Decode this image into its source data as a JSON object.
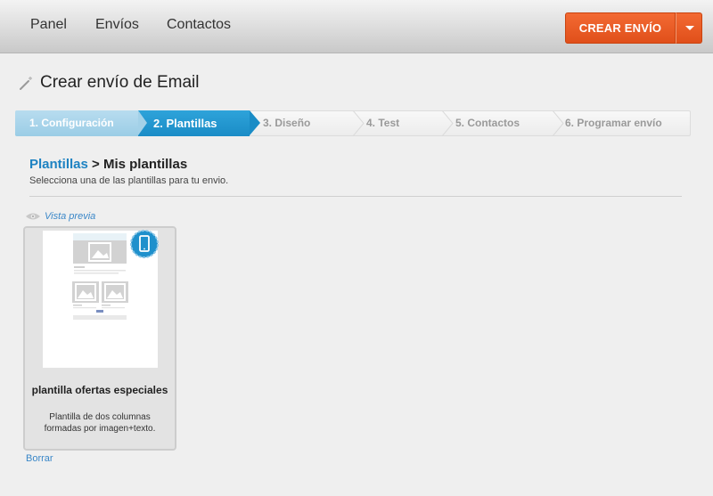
{
  "nav": {
    "items": [
      "Panel",
      "Envíos",
      "Contactos"
    ],
    "create_button": "CREAR ENVÍO"
  },
  "page": {
    "title": "Crear envío de Email"
  },
  "steps": [
    {
      "label": "1. Configuración",
      "state": "done"
    },
    {
      "label": "2. Plantillas",
      "state": "active"
    },
    {
      "label": "3. Diseño",
      "state": "pending"
    },
    {
      "label": "4. Test",
      "state": "pending"
    },
    {
      "label": "5. Contactos",
      "state": "pending"
    },
    {
      "label": "6. Programar envío",
      "state": "pending"
    }
  ],
  "breadcrumb": {
    "link": "Plantillas",
    "separator": " > ",
    "current": "Mis plantillas"
  },
  "subtitle": "Selecciona una de las plantillas para tu envio.",
  "preview_link": "Vista previa",
  "template": {
    "name": "plantilla ofertas especiales",
    "description": "Plantilla de dos columnas formadas por imagen+texto.",
    "mobile_icon": "mobile-phone-icon"
  },
  "delete_link": "Borrar",
  "colors": {
    "accent_orange": "#e8561f",
    "step_active": "#1a8cc6",
    "step_done": "#a8d4ea",
    "link_blue": "#1d82c2"
  }
}
